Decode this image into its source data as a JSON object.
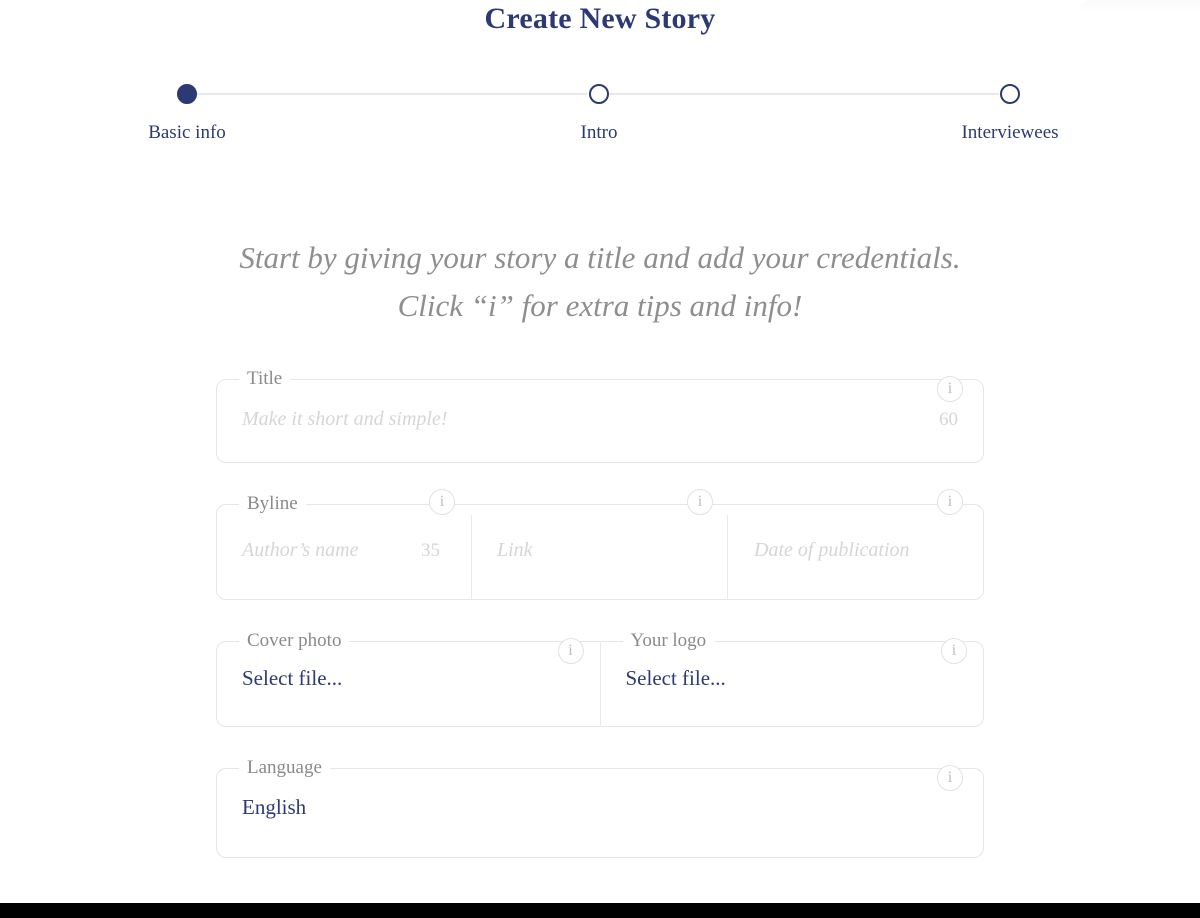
{
  "header": {
    "title": "Create New Story"
  },
  "stepper": {
    "steps": [
      {
        "label": "Basic info",
        "state": "active"
      },
      {
        "label": "Intro",
        "state": "inactive"
      },
      {
        "label": "Interviewees",
        "state": "inactive"
      }
    ]
  },
  "intro": {
    "text": "Start by giving your story a title and add your credentials. Click “i” for extra tips and info!"
  },
  "form": {
    "title_field": {
      "legend": "Title",
      "placeholder": "Make it short and simple!",
      "value": "",
      "counter": "60",
      "info_icon": "i"
    },
    "byline_field": {
      "legend": "Byline",
      "author": {
        "placeholder": "Author’s name",
        "value": "",
        "counter": "35",
        "info_icon": "i"
      },
      "link": {
        "placeholder": "Link",
        "value": "",
        "info_icon": "i"
      },
      "date": {
        "placeholder": "Date of publication",
        "value": "",
        "info_icon": "i"
      }
    },
    "cover_photo_field": {
      "legend": "Cover photo",
      "value": "Select file...",
      "info_icon": "i"
    },
    "logo_field": {
      "legend": "Your logo",
      "value": "Select file...",
      "info_icon": "i"
    },
    "language_field": {
      "legend": "Language",
      "value": "English",
      "info_icon": "i"
    }
  },
  "colors": {
    "navy": "#2b3a72",
    "muted_gray": "#8e8e8e",
    "placeholder_gray": "#d6d6d8",
    "border_gray": "#e6e6e9"
  }
}
